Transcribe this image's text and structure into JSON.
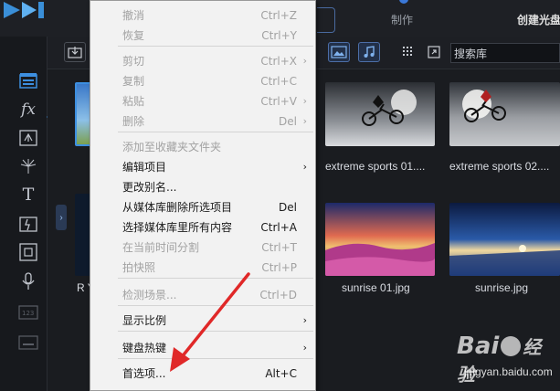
{
  "topbar": {
    "tab_make": "制作",
    "tab_disc": "创建光盘"
  },
  "toolbar": {
    "search_placeholder": "搜索库"
  },
  "sidebar_icons": [
    "media-room-icon",
    "fx-icon",
    "particle-icon",
    "title-room-icon",
    "text-icon",
    "transition-icon",
    "pip-icon",
    "microphone-icon",
    "chapter-icon",
    "subtitle-icon"
  ],
  "media": {
    "items": [
      {
        "label": "extreme sports 01...."
      },
      {
        "label": "extreme sports 02...."
      },
      {
        "label": "sunrise 01.jpg"
      },
      {
        "label": "sunrise.jpg"
      }
    ],
    "partial_label": "R Y"
  },
  "context_menu": {
    "items": [
      {
        "label": "撤消",
        "shortcut": "Ctrl+Z",
        "enabled": false,
        "submenu": false
      },
      {
        "label": "恢复",
        "shortcut": "Ctrl+Y",
        "enabled": false,
        "submenu": false
      },
      {
        "label": "剪切",
        "shortcut": "Ctrl+X",
        "enabled": false,
        "submenu": true
      },
      {
        "label": "复制",
        "shortcut": "Ctrl+C",
        "enabled": false,
        "submenu": false
      },
      {
        "label": "粘贴",
        "shortcut": "Ctrl+V",
        "enabled": false,
        "submenu": true
      },
      {
        "label": "删除",
        "shortcut": "Del",
        "enabled": false,
        "submenu": true
      },
      {
        "label": "添加至收藏夹文件夹",
        "shortcut": "",
        "enabled": false,
        "submenu": false
      },
      {
        "label": "编辑项目",
        "shortcut": "",
        "enabled": true,
        "submenu": true
      },
      {
        "label": "更改别名...",
        "shortcut": "",
        "enabled": true,
        "submenu": false
      },
      {
        "label": "从媒体库删除所选项目",
        "shortcut": "Del",
        "enabled": true,
        "submenu": false
      },
      {
        "label": "选择媒体库里所有内容",
        "shortcut": "Ctrl+A",
        "enabled": true,
        "submenu": false
      },
      {
        "label": "在当前时间分割",
        "shortcut": "Ctrl+T",
        "enabled": false,
        "submenu": false
      },
      {
        "label": "拍快照",
        "shortcut": "Ctrl+P",
        "enabled": false,
        "submenu": false
      },
      {
        "label": "检测场景...",
        "shortcut": "Ctrl+D",
        "enabled": false,
        "submenu": false
      },
      {
        "label": "显示比例",
        "shortcut": "",
        "enabled": true,
        "submenu": true
      },
      {
        "label": "键盘热键",
        "shortcut": "",
        "enabled": true,
        "submenu": true
      },
      {
        "label": "首选项...",
        "shortcut": "Alt+C",
        "enabled": true,
        "submenu": false
      }
    ],
    "submenu_arrow": "›"
  },
  "watermark": {
    "brand": "Bai",
    "brand_cn": "经验",
    "url": "jingyan.baidu.com"
  },
  "colors": {
    "accent": "#3d8fe0",
    "arrow_red": "#e02828"
  }
}
